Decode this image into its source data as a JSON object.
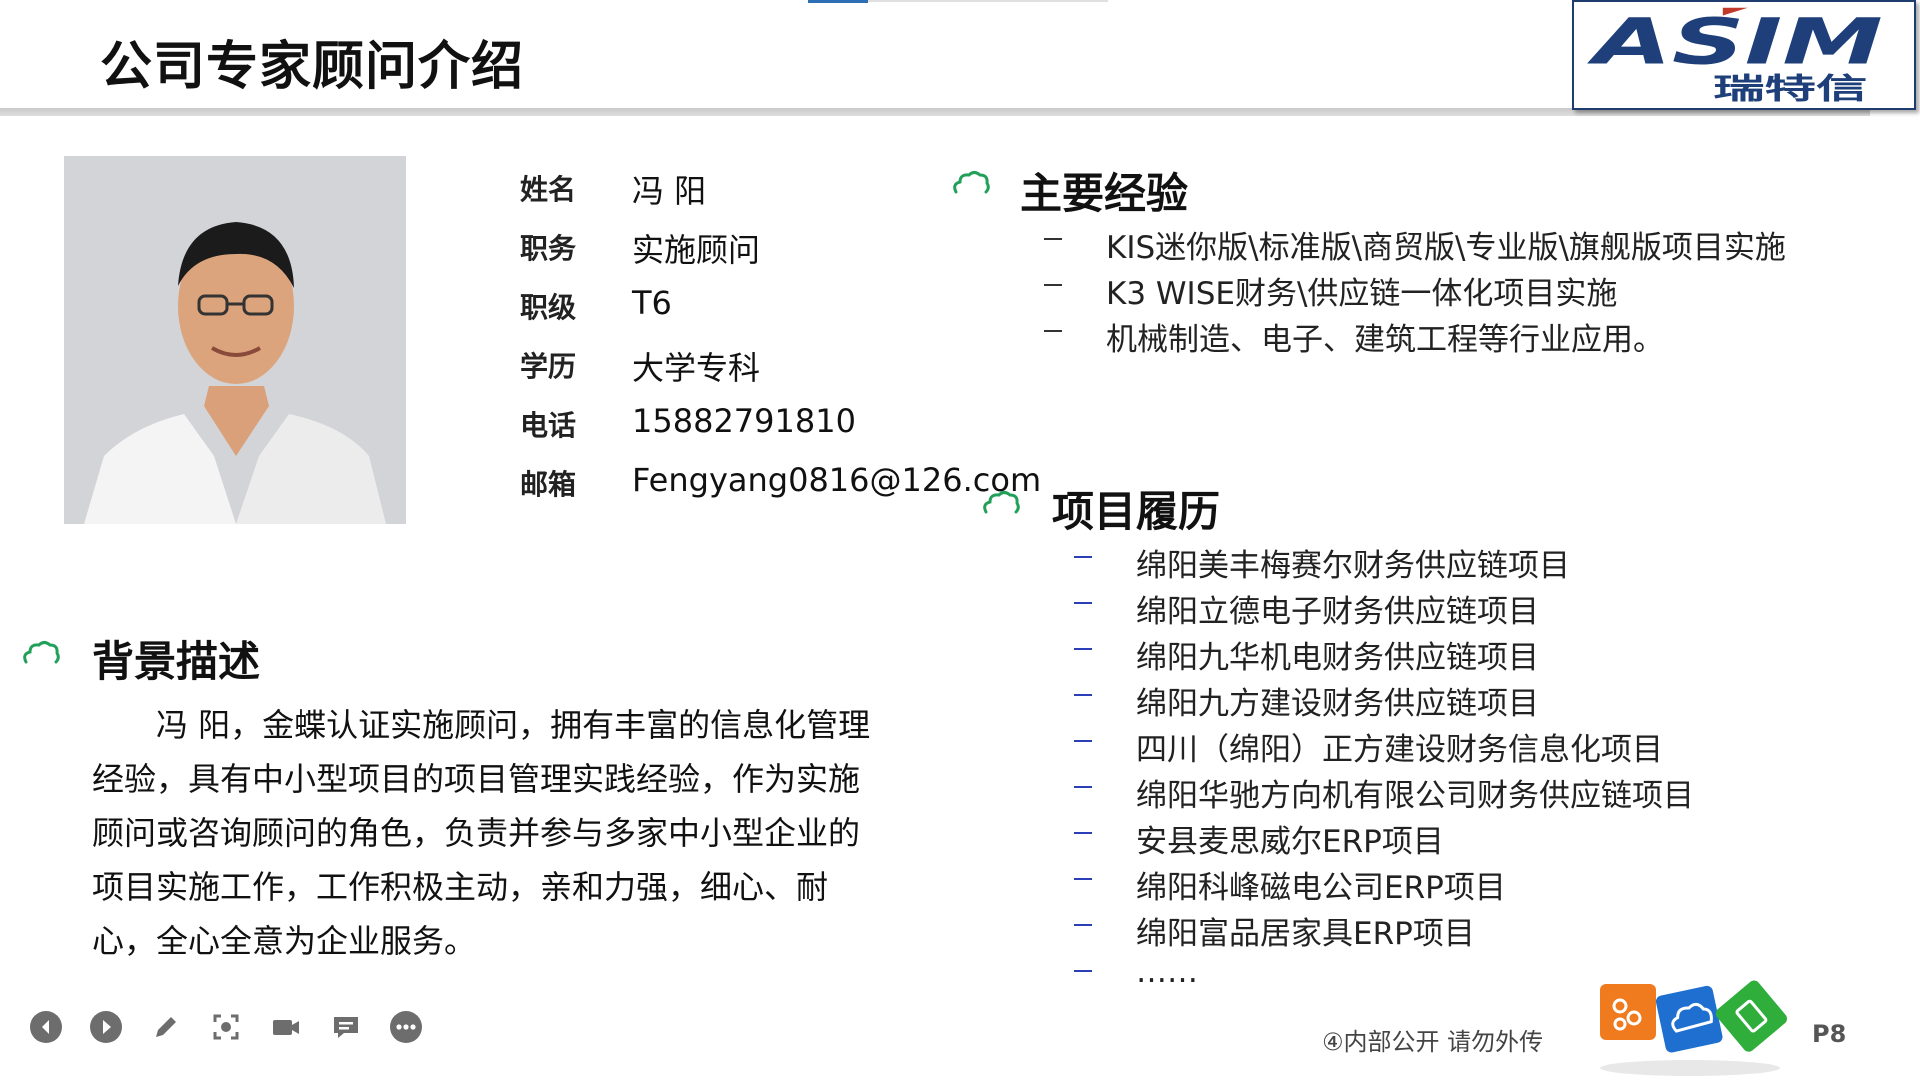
{
  "slide": {
    "title": "公司专家顾问介绍",
    "logo": {
      "brand_text": "ASIM",
      "chinese_text": "瑞特信",
      "brand_color": "#1e3f7a"
    },
    "profile": [
      {
        "label": "姓名",
        "value": "冯 阳"
      },
      {
        "label": "职务",
        "value": "实施顾问"
      },
      {
        "label": "职级",
        "value": "T6"
      },
      {
        "label": "学历",
        "value": "大学专科"
      },
      {
        "label": "电话",
        "value": "15882791810"
      },
      {
        "label": "邮箱",
        "value": "Fengyang0816@126.com"
      }
    ],
    "experience": {
      "title": "主要经验",
      "items": [
        "KIS迷你版\\标准版\\商贸版\\专业版\\旗舰版项目实施",
        "K3 WISE财务\\供应链一体化项目实施",
        "机械制造、电子、建筑工程等行业应用。"
      ]
    },
    "projects": {
      "title": "项目履历",
      "items": [
        "绵阳美丰梅赛尔财务供应链项目",
        "绵阳立德电子财务供应链项目",
        "绵阳九华机电财务供应链项目",
        "绵阳九方建设财务供应链项目",
        "四川（绵阳）正方建设财务信息化项目",
        "绵阳华驰方向机有限公司财务供应链项目",
        "安县麦思威尔ERP项目",
        "绵阳科峰磁电公司ERP项目",
        "绵阳富品居家具ERP项目",
        "……"
      ]
    },
    "background": {
      "title": "背景描述",
      "text": "冯 阳，金蝶认证实施顾问，拥有丰富的信息化管理经验，具有中小型项目的项目管理实践经验，作为实施顾问或咨询顾问的角色，负责并参与多家中小型企业的项目实施工作，工作积极主动，亲和力强，细心、耐心，全心全意为企业服务。"
    },
    "footer_note": "④内部公开 请勿外传",
    "page_number": "P8",
    "colors": {
      "cloud_icon": "#22a05a",
      "project_dash": "#2a3fb8",
      "experience_dash": "#333333"
    }
  },
  "toolbar": {
    "buttons": [
      {
        "name": "previous-slide",
        "icon": "chevron-left-icon"
      },
      {
        "name": "next-slide",
        "icon": "play-icon"
      },
      {
        "name": "pen",
        "icon": "pen-icon"
      },
      {
        "name": "zoom",
        "icon": "focus-icon"
      },
      {
        "name": "camera",
        "icon": "video-camera-icon"
      },
      {
        "name": "subtitle",
        "icon": "caption-icon"
      },
      {
        "name": "more",
        "icon": "more-icon"
      }
    ]
  }
}
